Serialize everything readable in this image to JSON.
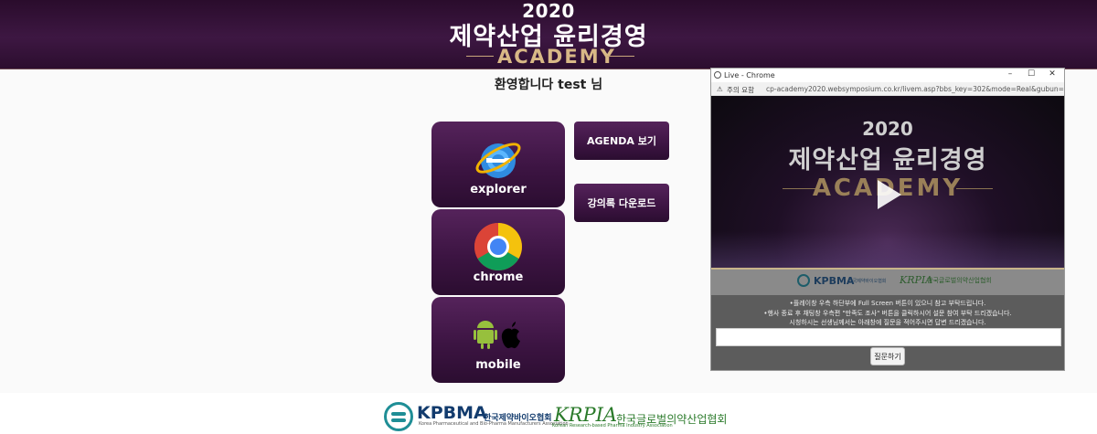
{
  "banner": {
    "year": "2020",
    "title": "제약산업 윤리경영",
    "academy": "ACADEMY"
  },
  "welcome": "환영합니다 test 님",
  "tiles": [
    {
      "label": "explorer",
      "icon": "internet-explorer-icon"
    },
    {
      "label": "chrome",
      "icon": "chrome-icon"
    },
    {
      "label": "mobile",
      "icon": "android-apple-icon"
    }
  ],
  "buttons": {
    "agenda": "AGENDA 보기",
    "download": "강의록 다운로드"
  },
  "popup": {
    "window_title": "Live - Chrome",
    "controls": {
      "minimize": "–",
      "maximize": "☐",
      "close": "✕"
    },
    "security": "주의 요함",
    "url": "cp-academy2020.websymposium.co.kr/livem.asp?bbs_key=302&mode=Real&gubun=",
    "video": {
      "year": "2020",
      "title": "제약산업 윤리경영",
      "academy": "ACADEMY"
    },
    "logos": {
      "kpbma": "KPBMA",
      "kpbma_kr": "한국제약바이오협회",
      "krpia": "KRPIA",
      "krpia_kr": "한국글로벌의약산업협회"
    },
    "notice_lines": [
      "•플레이창 우측 하단부에 Full Screen 버튼이 있으니 참고 부탁드립니다.",
      "•행사 종료 후 채팅창 우측편 \"만족도 조사\" 버튼을 클릭하시어 설문 참여 부탁 드리겠습니다.",
      "시청하시는 선생님께서는 아래창에 질문을 적어주시면 답변 드리겠습니다."
    ],
    "question_button": "질문하기"
  },
  "footer": {
    "kpbma": "KPBMA",
    "kpbma_kr": "한국제약바이오협회",
    "kpbma_sub": "Korea Pharmaceutical and Bio-Pharma Manufacturers Association",
    "krpia": "KRPIA",
    "krpia_sub": "Korean Research-based Pharma Industry Association",
    "krpia_kr": "한국글로벌의약산업협회"
  }
}
